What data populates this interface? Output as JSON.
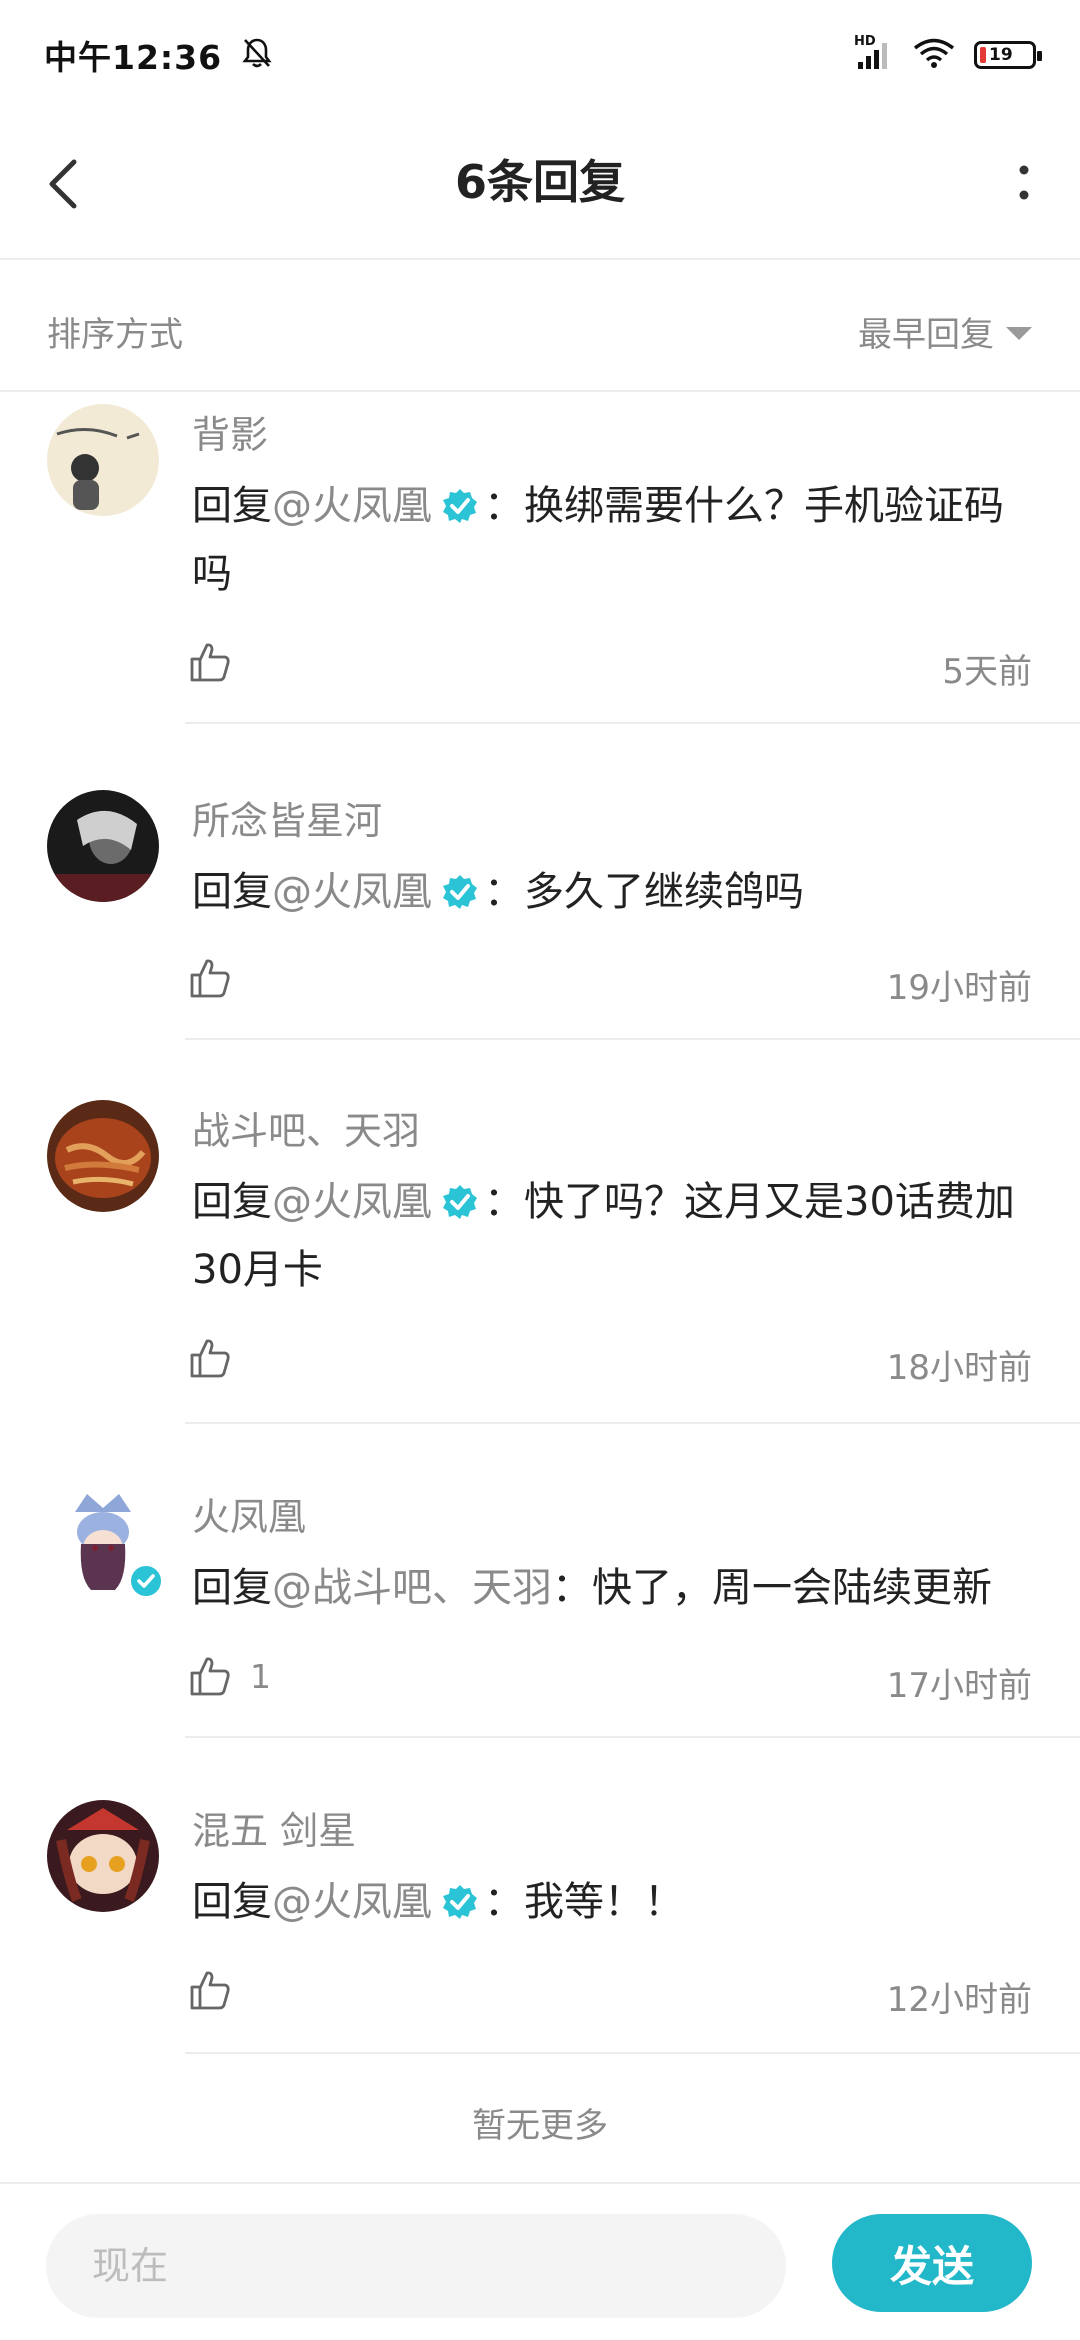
{
  "status_bar": {
    "time": "中午12:36",
    "network_label": "HD",
    "battery_level": "19"
  },
  "header": {
    "title": "6条回复"
  },
  "sort": {
    "label": "排序方式",
    "selected": "最早回复"
  },
  "replies": [
    {
      "user": "背影",
      "prefix": "回复",
      "mention": "@火凤凰",
      "mention_verified": true,
      "content": "：换绑需要什么？手机验证码吗",
      "likes": "",
      "time": "5天前"
    },
    {
      "user": "所念皆星河",
      "prefix": "回复",
      "mention": "@火凤凰",
      "mention_verified": true,
      "content": "：多久了继续鸽吗",
      "likes": "",
      "time": "19小时前"
    },
    {
      "user": "战斗吧、天羽",
      "prefix": "回复",
      "mention": "@火凤凰",
      "mention_verified": true,
      "content": "：快了吗？这月又是30话费加30月卡",
      "likes": "",
      "time": "18小时前"
    },
    {
      "user": "火凤凰",
      "prefix": "回复",
      "mention": "@战斗吧、天羽",
      "mention_verified": false,
      "content": "：快了，周一会陆续更新",
      "likes": "1",
      "time": "17小时前"
    },
    {
      "user": "混五 剑星",
      "prefix": "回复",
      "mention": "@火凤凰",
      "mention_verified": true,
      "content": "：我等！！",
      "likes": "",
      "time": "12小时前"
    }
  ],
  "footer_text": "暂无更多",
  "input": {
    "placeholder": "现在",
    "value": ""
  },
  "send_label": "发送",
  "colors": {
    "accent": "#22b8c9",
    "verified": "#2bc3d6",
    "muted_text": "#8a8a8a",
    "divider": "#ececec"
  }
}
